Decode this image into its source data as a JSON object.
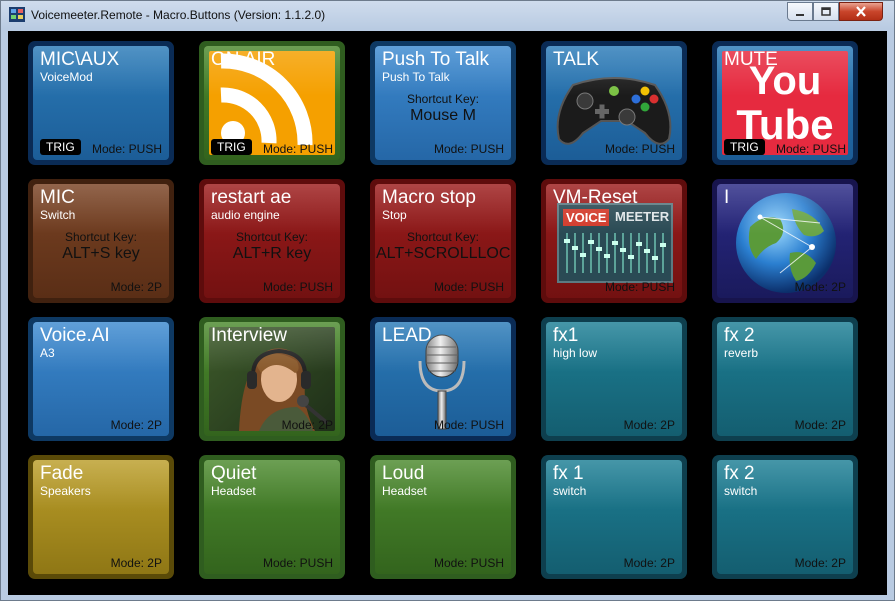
{
  "window": {
    "title": "Voicemeeter.Remote - Macro.Buttons (Version: 1.1.2.0)"
  },
  "controls": {
    "minimize_icon": "minimize-icon",
    "maximize_icon": "maximize-icon",
    "close_icon": "close-icon"
  },
  "colors": {
    "window_chrome": "#b9cbe2",
    "client_background": "#000000",
    "close_button": "#c9452b"
  },
  "buttons": [
    {
      "title": "MIC\\AUX",
      "subtitle": "VoiceMod",
      "mode": "Mode: PUSH",
      "trig": "TRIG",
      "color": "blue"
    },
    {
      "title": "ON AIR",
      "subtitle": "",
      "mode": "Mode: PUSH",
      "trig": "TRIG",
      "color": "green",
      "image": "rss-icon"
    },
    {
      "title": "Push To Talk",
      "subtitle": "Push To Talk",
      "shortcut_label": "Shortcut Key:",
      "shortcut_key": "Mouse M",
      "mode": "Mode: PUSH",
      "color": "lblue"
    },
    {
      "title": "TALK",
      "subtitle": "",
      "mode": "Mode: PUSH",
      "color": "blue",
      "image": "gamepad-icon"
    },
    {
      "title": "MUTE",
      "subtitle": "",
      "mode": "Mode: PUSH",
      "trig": "TRIG",
      "color": "blue",
      "image": "youtube-logo",
      "logo_text": [
        "You",
        "Tube"
      ]
    },
    {
      "title": "MIC",
      "subtitle": "Switch",
      "shortcut_label": "Shortcut Key:",
      "shortcut_key": "ALT+S key",
      "mode": "Mode: 2P",
      "color": "brown"
    },
    {
      "title": "restart ae",
      "subtitle": "audio engine",
      "shortcut_label": "Shortcut Key:",
      "shortcut_key": "ALT+R key",
      "mode": "Mode: PUSH",
      "color": "red"
    },
    {
      "title": "Macro stop",
      "subtitle": "Stop",
      "shortcut_label": "Shortcut Key:",
      "shortcut_key": "ALT+SCROLLLOCK",
      "mode": "Mode: PUSH",
      "color": "red"
    },
    {
      "title": "VM-Reset",
      "subtitle": "",
      "mode": "Mode: PUSH",
      "color": "red",
      "image": "voicemeeter-logo",
      "logo_text": [
        "VOICE",
        "MEETER"
      ]
    },
    {
      "title": "I",
      "subtitle": "",
      "mode": "Mode: 2P",
      "color": "purple",
      "image": "globe-icon"
    },
    {
      "title": "Voice.AI",
      "subtitle": "A3",
      "mode": "Mode: 2P",
      "color": "lblue"
    },
    {
      "title": "Interview",
      "subtitle": "",
      "mode": "Mode: 2P",
      "color": "green",
      "image": "interview-photo"
    },
    {
      "title": "LEAD",
      "subtitle": "",
      "mode": "Mode: PUSH",
      "color": "blue",
      "image": "microphone-icon"
    },
    {
      "title": "fx1",
      "subtitle": "high low",
      "mode": "Mode: 2P",
      "color": "teal"
    },
    {
      "title": "fx 2",
      "subtitle": "reverb",
      "mode": "Mode: 2P",
      "color": "teal"
    },
    {
      "title": "Fade",
      "subtitle": "Speakers",
      "mode": "Mode: 2P",
      "color": "yellow"
    },
    {
      "title": "Quiet",
      "subtitle": "Headset",
      "mode": "Mode: PUSH",
      "color": "green"
    },
    {
      "title": "Loud",
      "subtitle": "Headset",
      "mode": "Mode: PUSH",
      "color": "green"
    },
    {
      "title": "fx 1",
      "subtitle": "switch",
      "mode": "Mode: 2P",
      "color": "teal"
    },
    {
      "title": "fx 2",
      "subtitle": "switch",
      "mode": "Mode: 2P",
      "color": "teal"
    }
  ]
}
